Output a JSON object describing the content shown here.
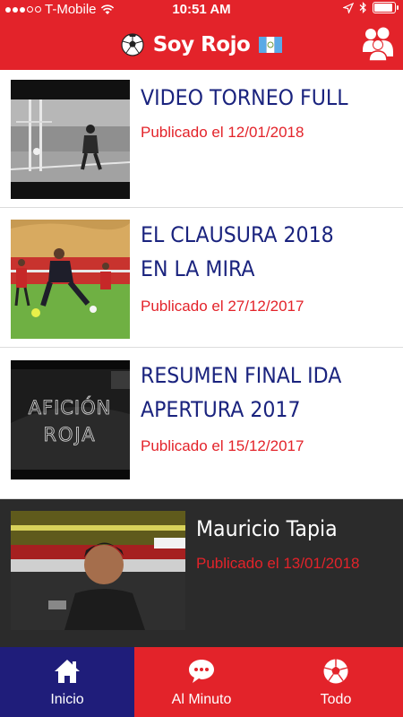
{
  "status_bar": {
    "carrier": "T-Mobile",
    "time": "10:51 AM"
  },
  "header": {
    "title": "Soy Rojo"
  },
  "posts": [
    {
      "title": "VIDEO TORNEO FULL",
      "date": "Publicado el 12/01/2018"
    },
    {
      "title": "EL CLAUSURA 2018 EN LA MIRA",
      "date": "Publicado el 27/12/2017"
    },
    {
      "title": "RESUMEN FINAL IDA APERTURA 2017",
      "date": "Publicado el 15/12/2017",
      "thumb_text": [
        "AFICIÓN",
        "ROJA"
      ]
    },
    {
      "title": "Mauricio Tapia",
      "date": "Publicado el 13/01/2018"
    }
  ],
  "tabs": [
    {
      "label": "Inicio"
    },
    {
      "label": "Al Minuto"
    },
    {
      "label": "Todo"
    }
  ],
  "colors": {
    "brand_red": "#e3232a",
    "title_blue": "#1a237e",
    "active_tab": "#1f1d7a"
  }
}
